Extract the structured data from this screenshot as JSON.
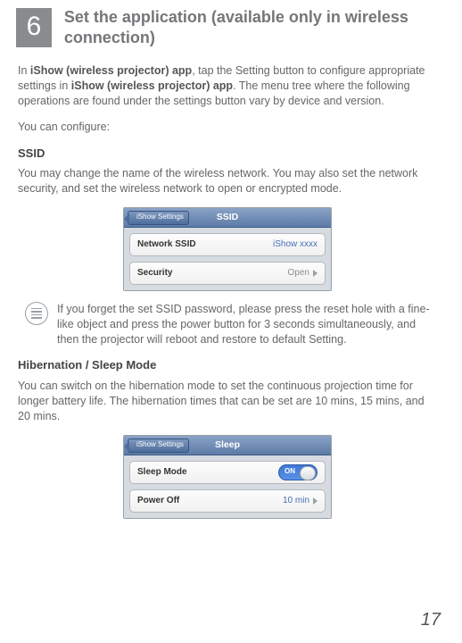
{
  "header": {
    "step": "6",
    "title": "Set the application (available only in wireless connection)"
  },
  "intro": {
    "p1a": "In ",
    "p1b": "iShow (wireless projector) app",
    "p1c": ", tap the Setting button to configure appropriate settings in ",
    "p1d": "iShow (wireless projector) app",
    "p1e": ". The menu tree where the following operations are found under the settings button vary by device and version.",
    "p2": "You can configure:"
  },
  "ssid": {
    "heading": "SSID",
    "desc": "You may change the name of the wireless network. You may also set the network security, and set the wireless network to open or encrypted mode.",
    "panel": {
      "back": "iShow Settings",
      "title": "SSID",
      "row1_label": "Network SSID",
      "row1_value": "iShow xxxx",
      "row2_label": "Security",
      "row2_value": "Open"
    },
    "note": "If you forget the set SSID password, please press the reset hole with a fine-like object and press the power button for 3 seconds simultaneously, and then the projector will reboot and restore to default Setting."
  },
  "sleep": {
    "heading": "Hibernation / Sleep Mode",
    "desc": "You can switch on the hibernation mode to set the continuous projection time for longer battery life. The hibernation times that can be set are 10 mins, 15 mins, and 20 mins.",
    "panel": {
      "back": "iShow Settings",
      "title": "Sleep",
      "row1_label": "Sleep Mode",
      "toggle": "ON",
      "row2_label": "Power Off",
      "row2_value": "10 min"
    }
  },
  "page_number": "17"
}
